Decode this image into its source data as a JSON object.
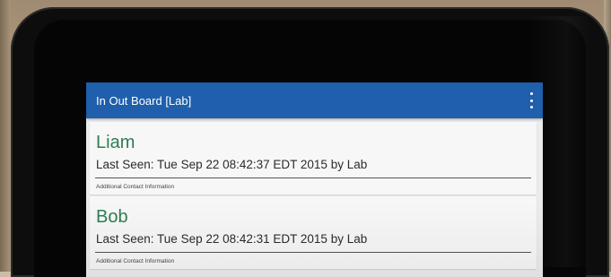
{
  "app_bar": {
    "title": "In Out Board [Lab]",
    "menu_icon": "overflow-menu-icon",
    "color": "#1f5fab"
  },
  "contacts": [
    {
      "name": "Liam",
      "last_seen": "Last Seen: Tue Sep 22 08:42:37 EDT 2015 by Lab",
      "additional_info": "Additional Contact Information"
    },
    {
      "name": "Bob",
      "last_seen": "Last Seen: Tue Sep 22 08:42:31 EDT 2015 by Lab",
      "additional_info": "Additional Contact Information"
    }
  ],
  "colors": {
    "name_text": "#2e7d52",
    "background": "#ececec"
  }
}
